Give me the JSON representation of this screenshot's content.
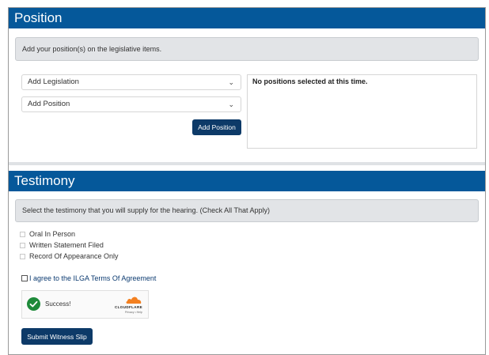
{
  "position": {
    "title": "Position",
    "info": "Add your position(s) on the legislative items.",
    "legislation_select": "Add Legislation",
    "position_select": "Add Position",
    "add_button": "Add Position",
    "empty_message": "No positions selected at this time."
  },
  "testimony": {
    "title": "Testimony",
    "info": "Select the testimony that you will supply for the hearing. (Check All That Apply)",
    "options": [
      "Oral In Person",
      "Written Statement Filed",
      "Record Of Appearance Only"
    ],
    "agree_label": "I agree to the ILGA Terms Of Agreement",
    "captcha": {
      "status": "Success!",
      "brand": "CLOUDFLARE",
      "links": "Privacy • Help"
    },
    "submit_button": "Submit Witness Slip"
  },
  "colors": {
    "header": "#05589a",
    "button": "#0d3a68",
    "success": "#1e8a3a",
    "cloud": "#f38020"
  }
}
